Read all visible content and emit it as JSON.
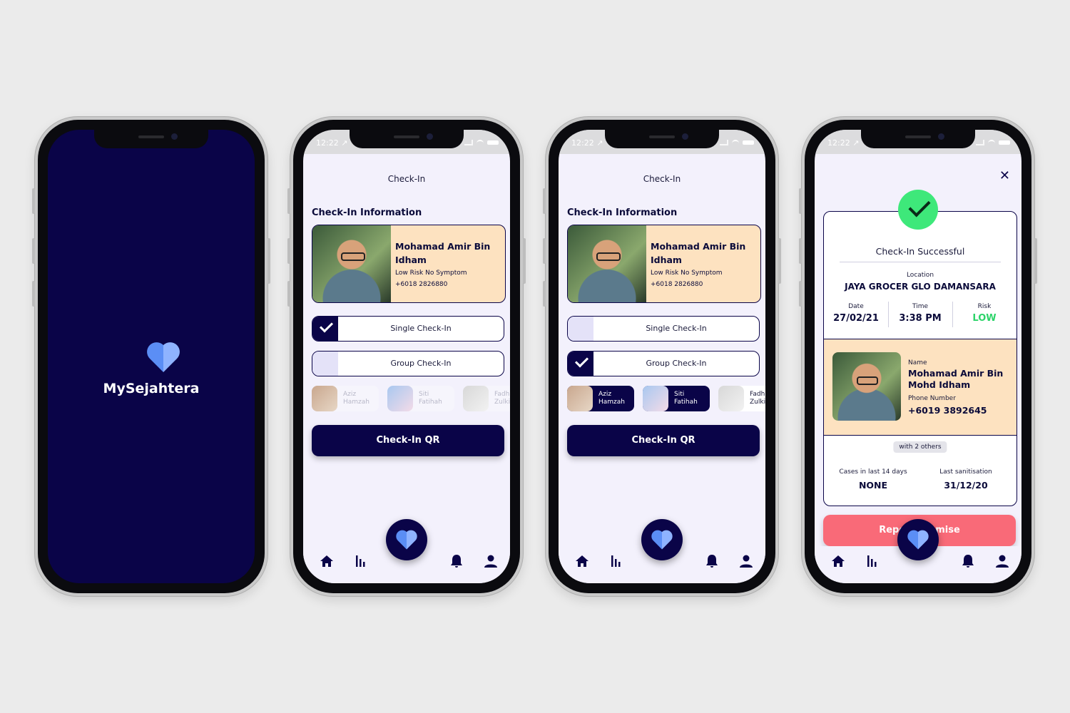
{
  "status": {
    "time": "12:22 ↗"
  },
  "splash": {
    "app_name": "MySejahtera"
  },
  "checkin": {
    "title": "Check-In",
    "section": "Check-In Information",
    "person": {
      "name": "Mohamad Amir Bin Idham",
      "risk": "Low Risk No Symptom",
      "phone": "+6018 2826880"
    },
    "options": {
      "single": "Single Check-In",
      "group": "Group Check-In"
    },
    "members": [
      {
        "first": "Aziz",
        "last": "Hamzah"
      },
      {
        "first": "Siti",
        "last": "Fatihah"
      },
      {
        "first": "Fadhl",
        "last": "Zulkifl"
      }
    ],
    "qr_label": "Check-In QR"
  },
  "success": {
    "title": "Check-In Successful",
    "location_label": "Location",
    "location": "JAYA GROCER GLO DAMANSARA",
    "date_label": "Date",
    "date": "27/02/21",
    "time_label": "Time",
    "time": "3:38 PM",
    "risk_label": "Risk",
    "risk": "LOW",
    "name_label": "Name",
    "name": "Mohamad Amir Bin Mohd Idham",
    "phone_label": "Phone Number",
    "phone": "+6019 3892645",
    "others": "with 2 others",
    "cases_label": "Cases in last 14 days",
    "cases": "NONE",
    "sanitisation_label": "Last sanitisation",
    "sanitisation": "31/12/20",
    "report_label": "Report Premise"
  },
  "colors": {
    "navy": "#0a0448",
    "peach": "#fde2c0",
    "accent": "#5b8ef5",
    "success": "#3ee87a",
    "danger": "#f96a78"
  }
}
